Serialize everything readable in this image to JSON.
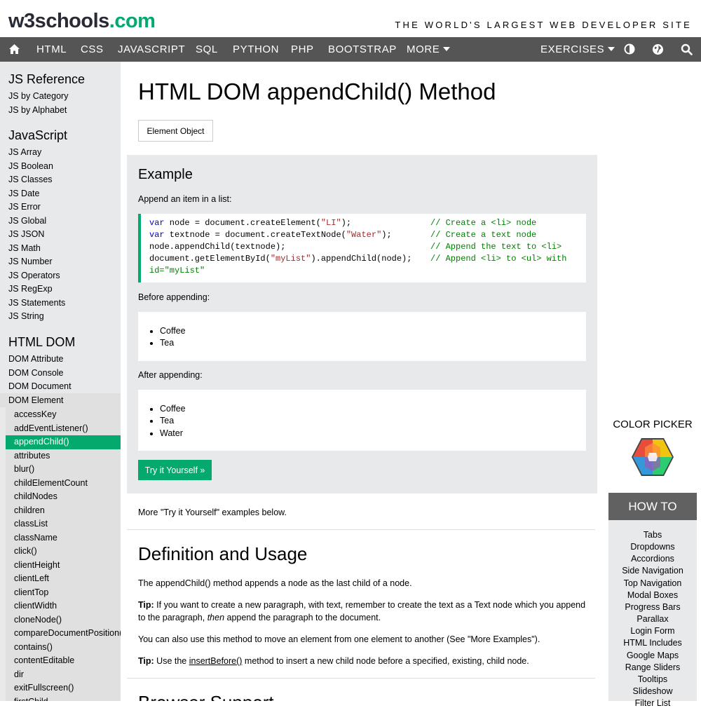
{
  "header": {
    "logo_main": "w3schools",
    "logo_suffix": ".com",
    "tagline": "THE WORLD'S LARGEST WEB DEVELOPER SITE"
  },
  "nav": {
    "items": [
      "HTML",
      "CSS",
      "JAVASCRIPT",
      "SQL",
      "PYTHON",
      "PHP",
      "BOOTSTRAP",
      "MORE"
    ],
    "exercises": "EXERCISES"
  },
  "sidebar": {
    "js_reference": {
      "title": "JS Reference",
      "links": [
        "JS by Category",
        "JS by Alphabet"
      ]
    },
    "javascript": {
      "title": "JavaScript",
      "links": [
        "JS Array",
        "JS Boolean",
        "JS Classes",
        "JS Date",
        "JS Error",
        "JS Global",
        "JS JSON",
        "JS Math",
        "JS Number",
        "JS Operators",
        "JS RegExp",
        "JS Statements",
        "JS String"
      ]
    },
    "html_dom": {
      "title": "HTML DOM",
      "links": [
        "DOM Attribute",
        "DOM Console",
        "DOM Document",
        "DOM Element"
      ]
    },
    "element_methods": [
      "accessKey",
      "addEventListener()",
      "appendChild()",
      "attributes",
      "blur()",
      "childElementCount",
      "childNodes",
      "children",
      "classList",
      "className",
      "click()",
      "clientHeight",
      "clientLeft",
      "clientTop",
      "clientWidth",
      "cloneNode()",
      "compareDocumentPosition()",
      "contains()",
      "contentEditable",
      "dir",
      "exitFullscreen()",
      "firstChild"
    ],
    "active": "appendChild()"
  },
  "main": {
    "title": "HTML DOM appendChild() Method",
    "parent_button": "Element Object",
    "example": {
      "heading": "Example",
      "intro": "Append an item in a list:",
      "code": [
        {
          "kw": "var",
          "a": " node = document.createElement(",
          "s": "\"LI\"",
          "b": ");",
          "c": "// Create a <li> node"
        },
        {
          "kw": "var",
          "a": " textnode = document.createTextNode(",
          "s": "\"Water\"",
          "b": ");",
          "c": "// Create a text node"
        },
        {
          "kw": "",
          "a": "node.appendChild(textnode);",
          "s": "",
          "b": "",
          "c": "// Append the text to <li>"
        },
        {
          "kw": "",
          "a": "document.getElementById(",
          "s": "\"myList\"",
          "b": ").appendChild(node);",
          "c": "// Append <li> to <ul> with"
        }
      ],
      "code_wrap": "id=\"myList\"",
      "before_label": "Before appending:",
      "before_items": [
        "Coffee",
        "Tea"
      ],
      "after_label": "After appending:",
      "after_items": [
        "Coffee",
        "Tea",
        "Water"
      ],
      "try_button": "Try it Yourself »"
    },
    "more_text": "More \"Try it Yourself\" examples below.",
    "definition": {
      "heading": "Definition and Usage",
      "p1": "The appendChild() method appends a node as the last child of a node.",
      "tip1_label": "Tip:",
      "tip1_a": " If you want to create a new paragraph, with text, remember to create the text as a Text node which you append to the paragraph, ",
      "tip1_em": "then",
      "tip1_b": " append the paragraph to the document.",
      "p3": "You can also use this method to move an element from one element to another (See \"More Examples\").",
      "tip2_label": "Tip:",
      "tip2_a": " Use the ",
      "tip2_link": "insertBefore()",
      "tip2_b": " method to insert a new child node before a specified, existing, child node."
    },
    "browser_support": "Browser Support"
  },
  "right": {
    "color_picker": "COLOR PICKER",
    "howto_title": "HOW TO",
    "howto_links": [
      "Tabs",
      "Dropdowns",
      "Accordions",
      "Side Navigation",
      "Top Navigation",
      "Modal Boxes",
      "Progress Bars",
      "Parallax",
      "Login Form",
      "HTML Includes",
      "Google Maps",
      "Range Sliders",
      "Tooltips",
      "Slideshow",
      "Filter List"
    ]
  },
  "colors": {
    "accent": "#04aa6d",
    "nav_bg": "#555555",
    "sidebar_bg": "#e7e9eb",
    "howto_bg": "#616161"
  }
}
